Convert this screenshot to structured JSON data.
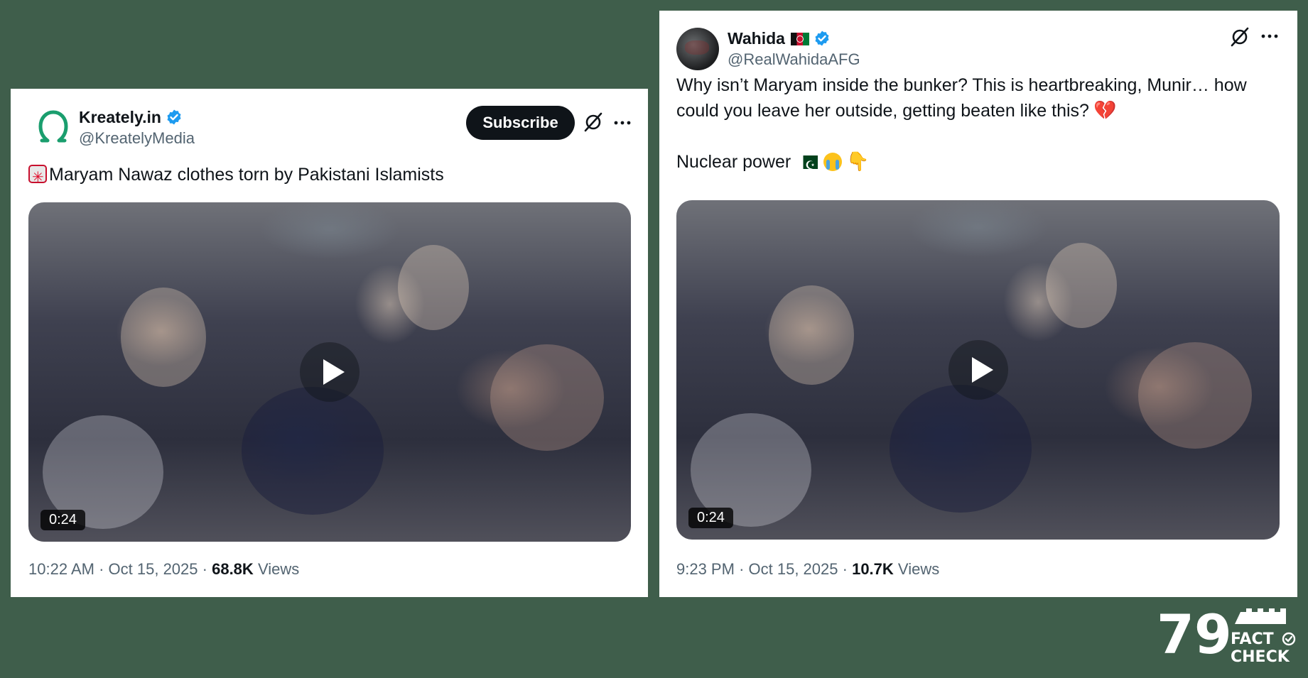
{
  "tweets": [
    {
      "author_name": "Kreately.in",
      "handle": "@KreatelyMedia",
      "subscribe_label": "Subscribe",
      "text": "Maryam Nawaz clothes torn by Pakistani Islamists",
      "video_duration": "0:24",
      "time": "10:22 AM",
      "date": "Oct 15, 2025",
      "views_count": "68.8K",
      "views_label": "Views"
    },
    {
      "author_name": "Wahida",
      "handle": "@RealWahidaAFG",
      "text": "Why isn’t Maryam inside the bunker? This is heartbreaking, Munir… how could you leave her outside, getting beaten like this?",
      "text_2": "Nuclear power",
      "video_duration": "0:24",
      "time": "9:23 PM",
      "date": "Oct 15, 2025",
      "views_count": "10.7K",
      "views_label": "Views"
    }
  ],
  "separator": "·",
  "watermark": {
    "brand_number": "79",
    "brand_text_1": "FACT",
    "brand_text_2": "CHECK"
  },
  "colors": {
    "background": "#3f5e4b",
    "verified": "#1d9bf0",
    "kreately_logo": "#1a9e6e"
  }
}
